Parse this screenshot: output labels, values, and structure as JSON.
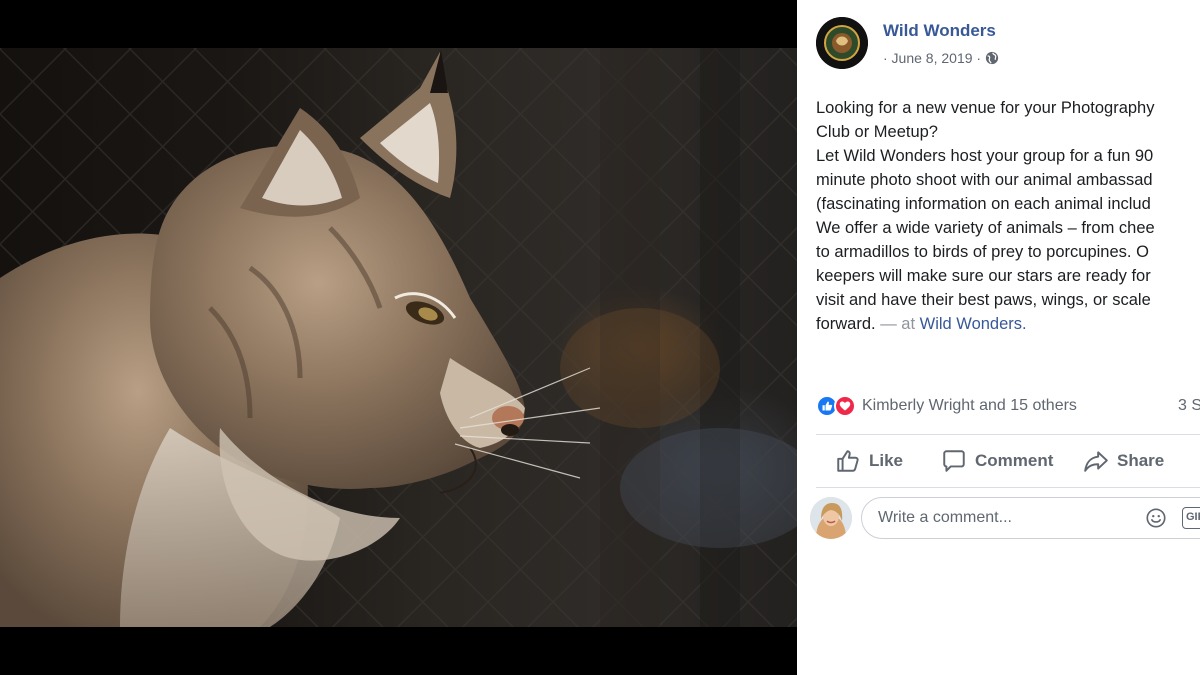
{
  "photo": {
    "alt": "Lynx profile photo"
  },
  "post": {
    "page_name": "Wild Wonders",
    "date": "· June 8, 2019 ·",
    "privacy_icon": "globe-icon",
    "text_lines": [
      "Looking for a new venue for your Photography",
      "Club or Meetup?",
      "Let Wild Wonders host your group for a fun 90",
      "minute photo shoot with our animal ambassad",
      "(fascinating information on each animal includ",
      "We offer a wide variety of animals – from chee",
      "to armadillos to birds of prey to porcupines. O",
      "keepers will make sure our stars are ready for",
      "visit and have their best paws, wings, or scale"
    ],
    "last_line": "forward.",
    "at_text": " — at ",
    "location_link": "Wild Wonders."
  },
  "reactions": {
    "icons": [
      "like-reaction-icon",
      "love-reaction-icon"
    ],
    "names": "Kimberly Wright and 15 others",
    "shares": "3 S"
  },
  "actions": {
    "like": "Like",
    "comment": "Comment",
    "share": "Share"
  },
  "comment": {
    "placeholder": "Write a comment...",
    "gif_label": "GIF"
  },
  "colors": {
    "link": "#385898",
    "like_blue": "#1877f2",
    "love_red": "#f0284a",
    "secondary_text": "#606770"
  }
}
